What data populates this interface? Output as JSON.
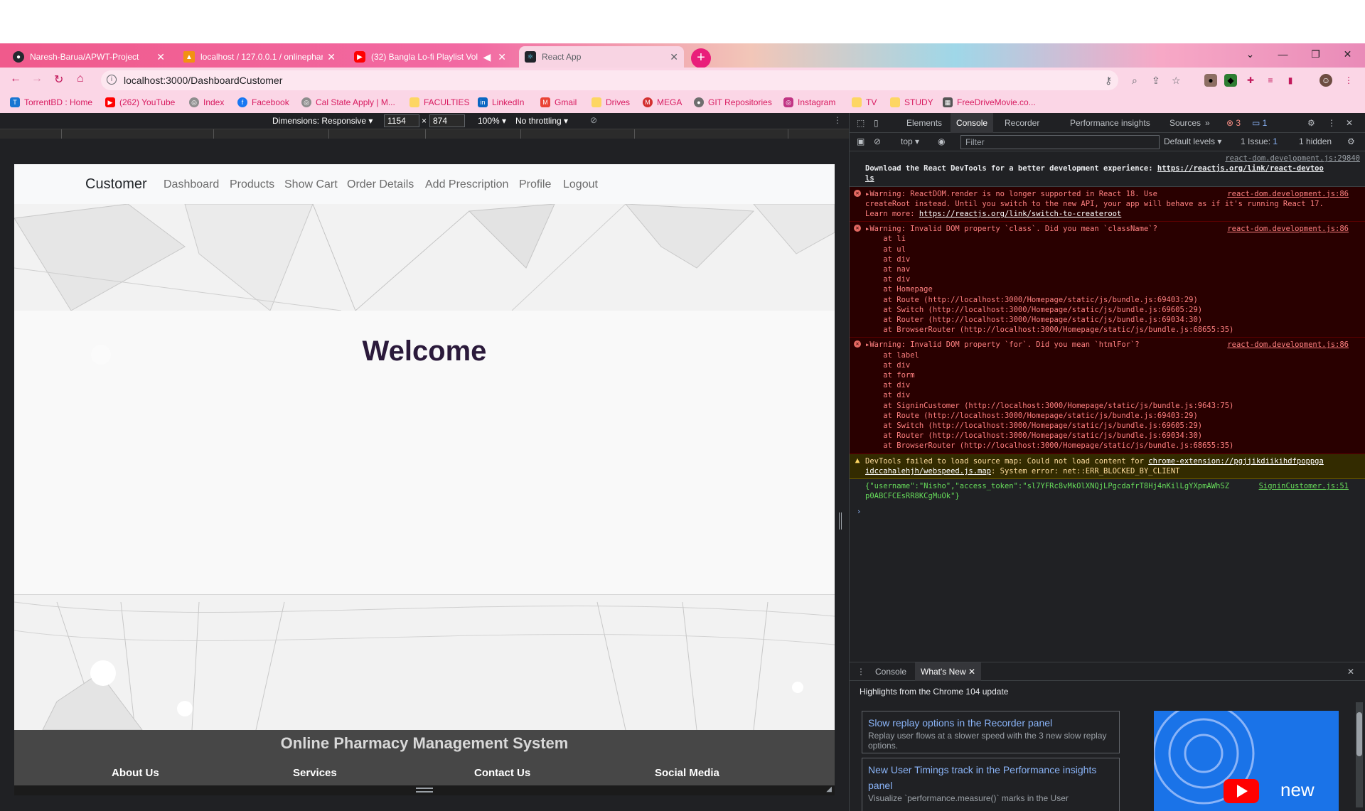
{
  "browser": {
    "tabs": [
      {
        "title": "Naresh-Barua/APWT-Project",
        "icon": "github-icon"
      },
      {
        "title": "localhost / 127.0.0.1 / onlinephar",
        "icon": "phpmyadmin-icon"
      },
      {
        "title": "(32) Bangla Lo-fi Playlist Vol.",
        "icon": "youtube-icon"
      },
      {
        "title": "React App",
        "icon": "react-icon"
      }
    ],
    "url": "localhost:3000/DashboardCustomer",
    "bookmarks": [
      "TorrentBD : Home",
      "(262) YouTube",
      "Index",
      "Facebook",
      "Cal State Apply | M...",
      "FACULTIES",
      "LinkedIn",
      "Gmail",
      "Drives",
      "MEGA",
      "GIT Repositories",
      "Instagram",
      "TV",
      "STUDY",
      "FreeDriveMovie.co..."
    ],
    "colors": {
      "tab_strip": "#f05a8c",
      "toolbar": "#fbd6e6",
      "accent": "#e91e7a"
    }
  },
  "device_toolbar": {
    "dimensions_label": "Dimensions: Responsive",
    "width": "1154",
    "times": "×",
    "height": "874",
    "zoom": "100%",
    "throttling": "No throttling"
  },
  "page": {
    "brand": "Customer",
    "nav_links": [
      "Dashboard",
      "Products",
      "Show Cart",
      "Order Details",
      "Add Prescription",
      "Profile",
      "Logout"
    ],
    "heading": "Welcome",
    "footer_title": "Online Pharmacy Management System",
    "footer_columns": [
      "About Us",
      "Services",
      "Contact Us",
      "Social Media"
    ]
  },
  "devtools": {
    "tabs": [
      "Elements",
      "Console",
      "Recorder",
      "Performance insights",
      "Sources"
    ],
    "active_tab": "Console",
    "error_count": "3",
    "message_count": "1",
    "context": "top",
    "filter_placeholder": "Filter",
    "levels": "Default levels",
    "issues": "1 Issue:",
    "issues_count": "1",
    "hidden": "1 hidden",
    "console": {
      "devtools_src": "react-dom.development.js:29840",
      "devtools_line1": "Download the React DevTools for a better development experience: ",
      "devtools_link1": "https://reactjs.org/link/react-devtoo",
      "devtools_link2": "ls",
      "err1_src": "react-dom.development.js:86",
      "err1_line1": "Warning: ReactDOM.render is no longer supported in React 18. Use",
      "err1_line2": "createRoot instead. Until you switch to the new API, your app will behave as if it's running React 17.",
      "err1_line3": "Learn more: ",
      "err1_link": "https://reactjs.org/link/switch-to-createroot",
      "err2_src": "react-dom.development.js:86",
      "err2_line1": "Warning: Invalid DOM property `class`. Did you mean `className`?",
      "err2_stack": [
        "    at li",
        "    at ul",
        "    at div",
        "    at nav",
        "    at div",
        "    at Homepage",
        "    at Route (http://localhost:3000/Homepage/static/js/bundle.js:69403:29)",
        "    at Switch (http://localhost:3000/Homepage/static/js/bundle.js:69605:29)",
        "    at Router (http://localhost:3000/Homepage/static/js/bundle.js:69034:30)",
        "    at BrowserRouter (http://localhost:3000/Homepage/static/js/bundle.js:68655:35)"
      ],
      "err3_src": "react-dom.development.js:86",
      "err3_line1": "Warning: Invalid DOM property `for`. Did you mean `htmlFor`?",
      "err3_stack": [
        "    at label",
        "    at div",
        "    at form",
        "    at div",
        "    at div",
        "    at SigninCustomer (http://localhost:3000/Homepage/static/js/bundle.js:9643:75)",
        "    at Route (http://localhost:3000/Homepage/static/js/bundle.js:69403:29)",
        "    at Switch (http://localhost:3000/Homepage/static/js/bundle.js:69605:29)",
        "    at Router (http://localhost:3000/Homepage/static/js/bundle.js:69034:30)",
        "    at BrowserRouter (http://localhost:3000/Homepage/static/js/bundle.js:68655:35)"
      ],
      "warn_line1": "DevTools failed to load source map: Could not load content for ",
      "warn_link1": "chrome-extension://pgjjikdiikihdfpoppga",
      "warn_link2": "idccahalehjh/webspeed.js.map",
      "warn_line2": ": System error: net::ERR_BLOCKED_BY_CLIENT",
      "log_src": "SigninCustomer.js:51",
      "log_line1": "{\"username\":\"Nisho\",\"access_token\":\"sl7YFRc8vMkOlXNQjLPgcdafrT8Hj4nKilLgYXpmAWhSZ",
      "log_line2": "p0ABCFCEsRR8KCgMuOk\"}"
    },
    "drawer": {
      "tabs": [
        "Console",
        "What's New"
      ],
      "active": "What's New",
      "headline": "Highlights from the Chrome 104 update",
      "cards": [
        {
          "title": "Slow replay options in the Recorder panel",
          "desc": "Replay user flows at a slower speed with the 3 new slow replay options."
        },
        {
          "title": "New User Timings track in the Performance insights panel",
          "desc": "Visualize `performance.measure()` marks in the User"
        }
      ],
      "promo_text": "new"
    }
  }
}
